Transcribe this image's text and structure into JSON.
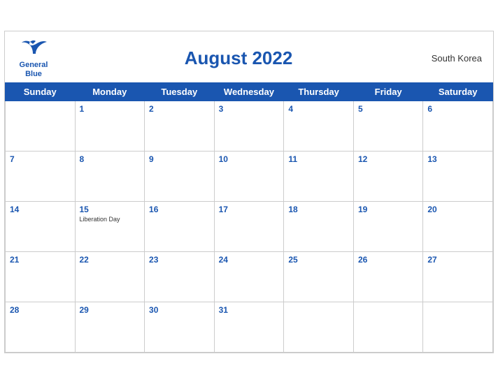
{
  "header": {
    "logo_line1": "General",
    "logo_line2": "Blue",
    "title": "August 2022",
    "country": "South Korea"
  },
  "weekdays": [
    "Sunday",
    "Monday",
    "Tuesday",
    "Wednesday",
    "Thursday",
    "Friday",
    "Saturday"
  ],
  "weeks": [
    [
      {
        "date": "",
        "empty": true
      },
      {
        "date": "1"
      },
      {
        "date": "2"
      },
      {
        "date": "3"
      },
      {
        "date": "4"
      },
      {
        "date": "5"
      },
      {
        "date": "6"
      }
    ],
    [
      {
        "date": "7"
      },
      {
        "date": "8"
      },
      {
        "date": "9"
      },
      {
        "date": "10"
      },
      {
        "date": "11"
      },
      {
        "date": "12"
      },
      {
        "date": "13"
      }
    ],
    [
      {
        "date": "14"
      },
      {
        "date": "15",
        "holiday": "Liberation Day"
      },
      {
        "date": "16"
      },
      {
        "date": "17"
      },
      {
        "date": "18"
      },
      {
        "date": "19"
      },
      {
        "date": "20"
      }
    ],
    [
      {
        "date": "21"
      },
      {
        "date": "22"
      },
      {
        "date": "23"
      },
      {
        "date": "24"
      },
      {
        "date": "25"
      },
      {
        "date": "26"
      },
      {
        "date": "27"
      }
    ],
    [
      {
        "date": "28"
      },
      {
        "date": "29"
      },
      {
        "date": "30"
      },
      {
        "date": "31"
      },
      {
        "date": ""
      },
      {
        "date": ""
      },
      {
        "date": ""
      }
    ]
  ]
}
